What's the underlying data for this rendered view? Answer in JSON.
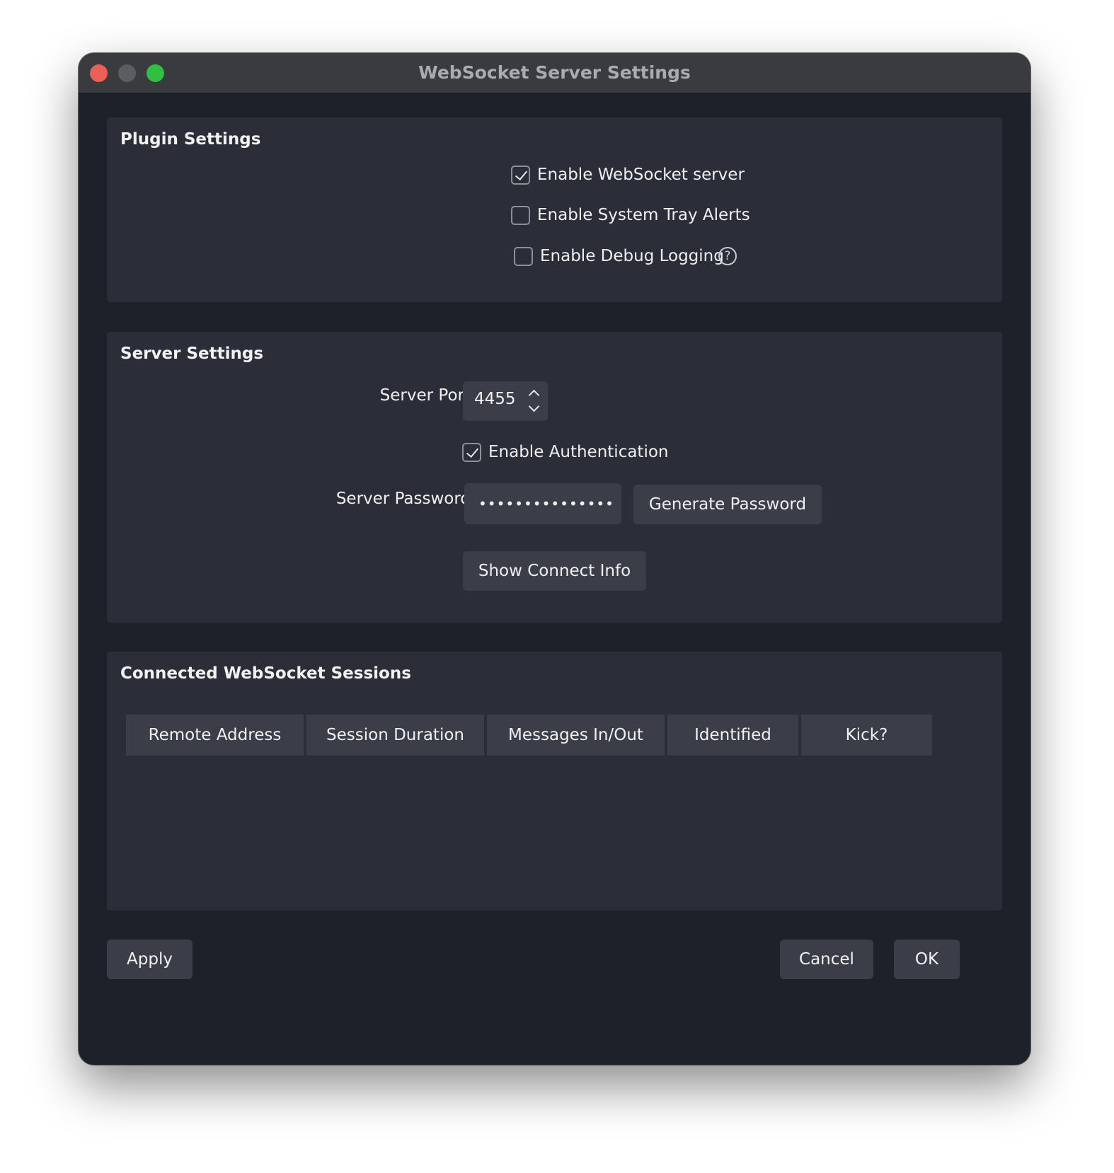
{
  "window": {
    "title": "WebSocket Server Settings"
  },
  "plugin_settings": {
    "title": "Plugin Settings",
    "enable_server": {
      "label": "Enable WebSocket server",
      "checked": true
    },
    "enable_tray_alerts": {
      "label": "Enable System Tray Alerts",
      "checked": false
    },
    "enable_debug_logging": {
      "label": "Enable Debug Logging",
      "checked": false,
      "help_glyph": "?"
    }
  },
  "server_settings": {
    "title": "Server Settings",
    "port_label": "Server Port",
    "port_value": "4455",
    "enable_auth": {
      "label": "Enable Authentication",
      "checked": true
    },
    "password_label": "Server Password",
    "password_value": "•••••••••••••••",
    "generate_password_label": "Generate Password",
    "show_connect_info_label": "Show Connect Info"
  },
  "sessions": {
    "title": "Connected WebSocket Sessions",
    "columns": [
      "Remote Address",
      "Session Duration",
      "Messages In/Out",
      "Identified",
      "Kick?"
    ],
    "rows": []
  },
  "footer": {
    "apply_label": "Apply",
    "cancel_label": "Cancel",
    "ok_label": "OK"
  }
}
